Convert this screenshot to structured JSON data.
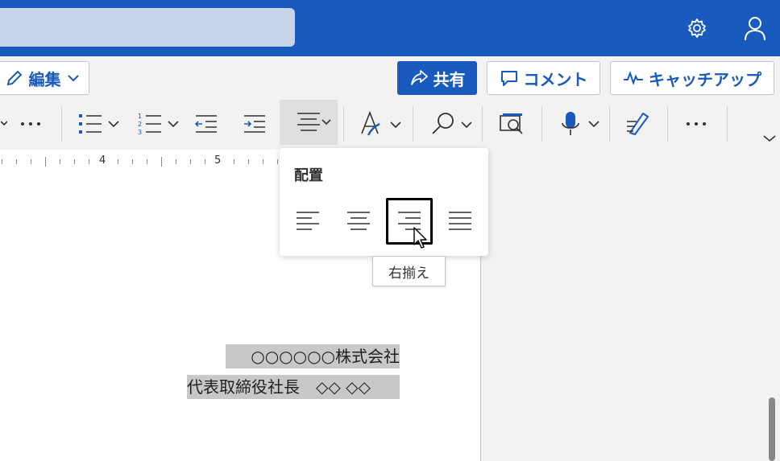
{
  "header": {
    "search_placeholder": "",
    "settings_icon": "gear-icon",
    "account_icon": "person-icon"
  },
  "command_bar": {
    "edit_label": "編集",
    "share_label": "共有",
    "comment_label": "コメント",
    "catchup_label": "キャッチアップ"
  },
  "ribbon": {
    "items": [
      "more-icon",
      "bullet-list-icon",
      "numbered-list-icon",
      "decrease-indent-icon",
      "increase-indent-icon",
      "align-icon",
      "styles-icon",
      "find-icon",
      "editor-icon",
      "dictate-icon",
      "designer-icon",
      "more-icon",
      "expand-icon"
    ]
  },
  "ruler": {
    "marks": [
      "4",
      "5"
    ]
  },
  "align_popup": {
    "title": "配置",
    "options": [
      "align-left",
      "align-center",
      "align-right",
      "justify"
    ],
    "selected": "align-right"
  },
  "tooltip": {
    "text": "右揃え"
  },
  "document": {
    "lines": [
      "○○○○○○株式会社",
      "代表取締役社長　◇◇ ◇◇"
    ]
  },
  "colors": {
    "accent": "#185abd",
    "selection": "#c8c8c8"
  }
}
